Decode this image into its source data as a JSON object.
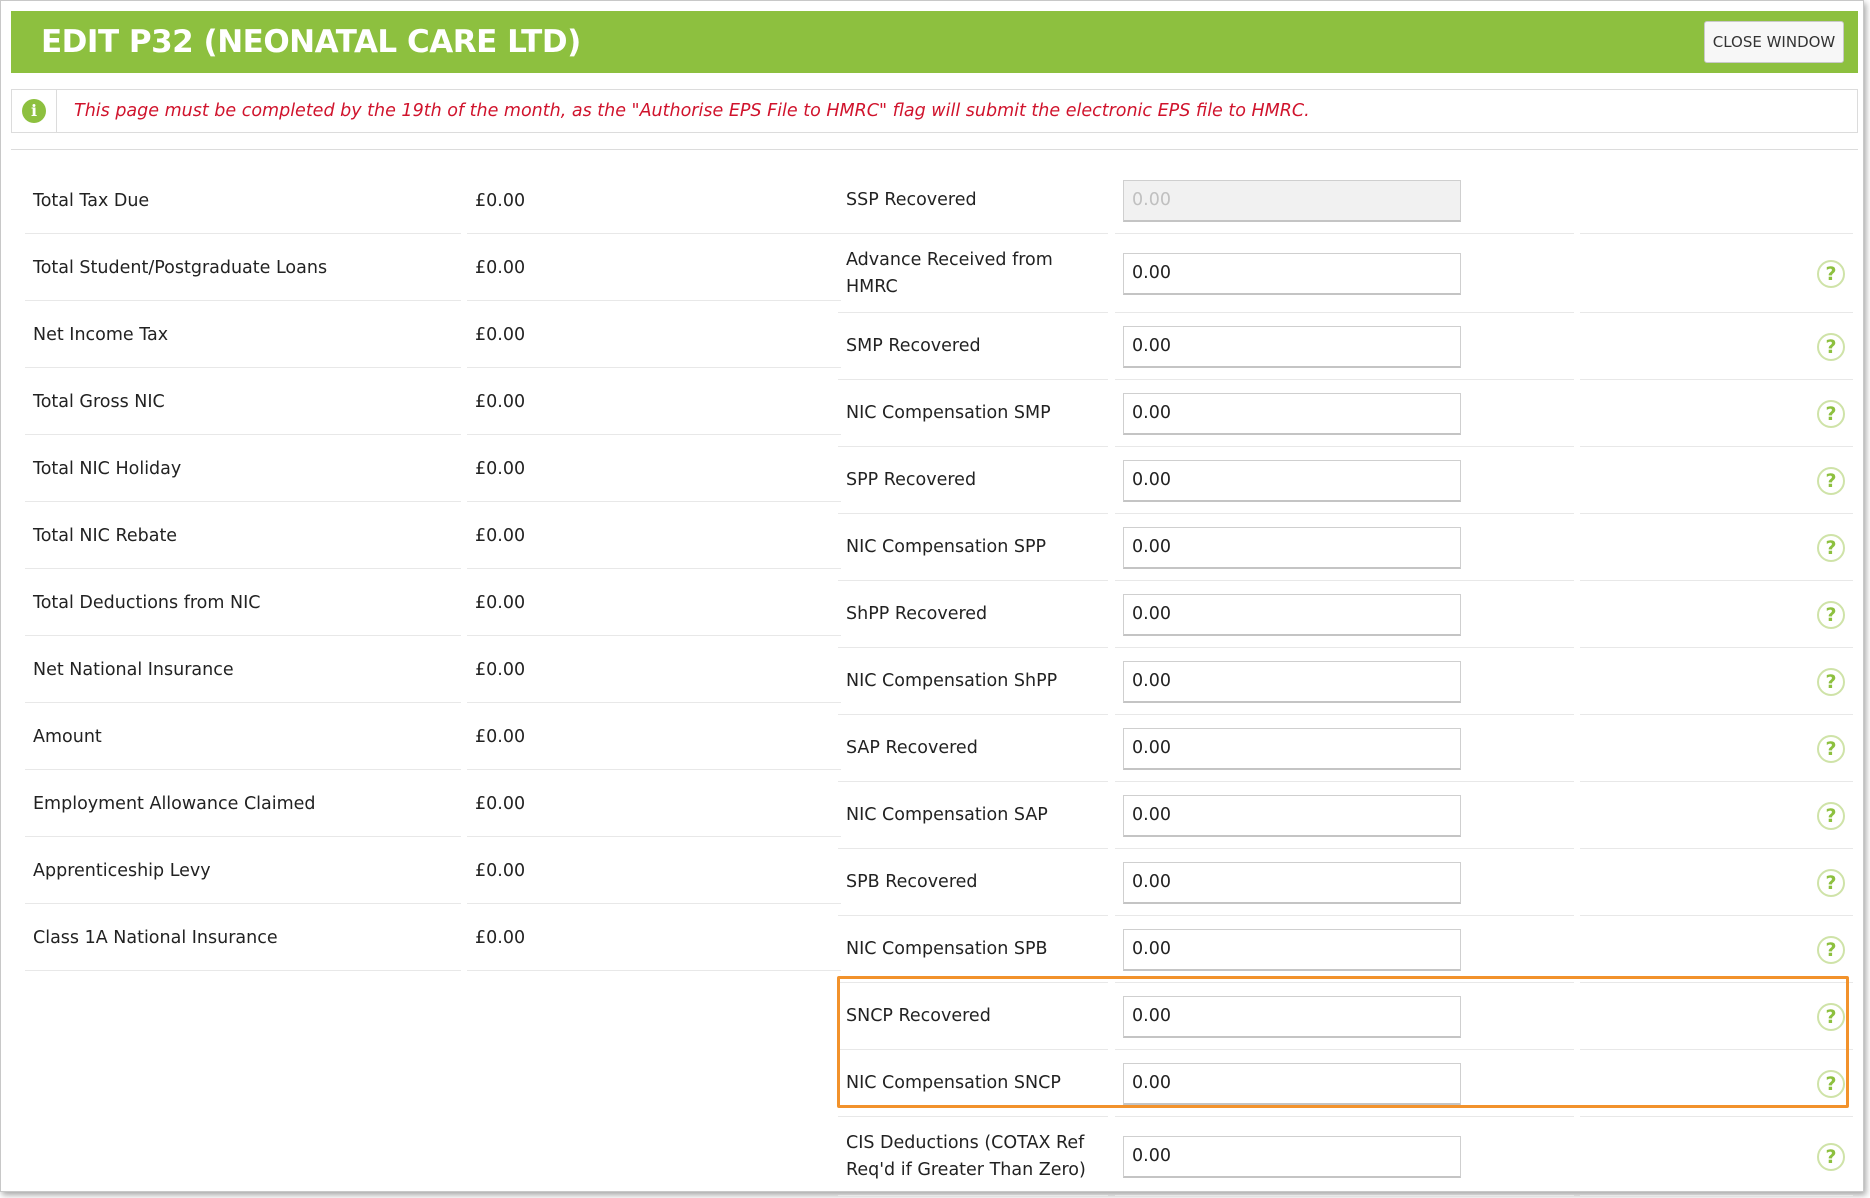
{
  "header": {
    "title": "EDIT P32 (NEONATAL CARE LTD)",
    "close_label": "CLOSE WINDOW",
    "accent_color": "#8dc03f"
  },
  "info": {
    "icon": "info-icon",
    "message": "This page must be completed by the 19th of the month, as the \"Authorise EPS File to HMRC\" flag will submit the electronic EPS file to HMRC."
  },
  "summary": [
    {
      "label": "Total Tax Due",
      "value": "£0.00"
    },
    {
      "label": "Total Student/Postgraduate Loans",
      "value": "£0.00"
    },
    {
      "label": "Net Income Tax",
      "value": "£0.00"
    },
    {
      "label": "Total Gross NIC",
      "value": "£0.00"
    },
    {
      "label": "Total NIC Holiday",
      "value": "£0.00"
    },
    {
      "label": "Total NIC Rebate",
      "value": "£0.00"
    },
    {
      "label": "Total Deductions from NIC",
      "value": "£0.00"
    },
    {
      "label": "Net National Insurance",
      "value": "£0.00"
    },
    {
      "label": "Amount",
      "value": "£0.00"
    },
    {
      "label": "Employment Allowance Claimed",
      "value": "£0.00"
    },
    {
      "label": "Apprenticeship Levy",
      "value": "£0.00"
    },
    {
      "label": "Class 1A National Insurance",
      "value": "£0.00"
    }
  ],
  "recoveries": [
    {
      "label": "SSP Recovered",
      "value": "0.00",
      "disabled": true,
      "help": false
    },
    {
      "label": "Advance Received from HMRC",
      "value": "0.00",
      "help": true
    },
    {
      "label": "SMP Recovered",
      "value": "0.00",
      "help": true
    },
    {
      "label": "NIC Compensation SMP",
      "value": "0.00",
      "help": true
    },
    {
      "label": "SPP Recovered",
      "value": "0.00",
      "help": true
    },
    {
      "label": "NIC Compensation SPP",
      "value": "0.00",
      "help": true
    },
    {
      "label": "ShPP Recovered",
      "value": "0.00",
      "help": true
    },
    {
      "label": "NIC Compensation ShPP",
      "value": "0.00",
      "help": true
    },
    {
      "label": "SAP Recovered",
      "value": "0.00",
      "help": true
    },
    {
      "label": "NIC Compensation SAP",
      "value": "0.00",
      "help": true
    },
    {
      "label": "SPB Recovered",
      "value": "0.00",
      "help": true
    },
    {
      "label": "NIC Compensation SPB",
      "value": "0.00",
      "help": true
    },
    {
      "label": "SNCP Recovered",
      "value": "0.00",
      "help": true,
      "highlighted": true
    },
    {
      "label": "NIC Compensation SNCP",
      "value": "0.00",
      "help": true,
      "highlighted": true
    },
    {
      "label": "CIS Deductions (COTAX Ref Req'd if Greater Than Zero)",
      "value": "0.00",
      "help": true
    }
  ],
  "help_glyph": "?",
  "highlight_color": "#f2922b"
}
